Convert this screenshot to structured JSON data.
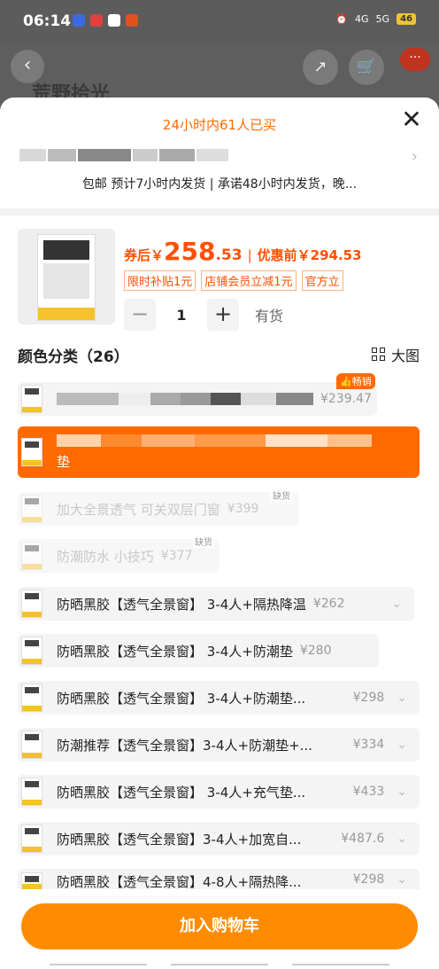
{
  "status_bar": {
    "time": "06:14",
    "right": [
      "4G",
      "5G"
    ],
    "battery": "46"
  },
  "background": {
    "title_hint": "荒野拾光"
  },
  "sheet": {
    "bought_text": "24小时内61人已买",
    "close_icon": "close-icon",
    "delivery_text": "包邮 预计7小时内发货 | 承诺48小时内发货，晚..."
  },
  "product": {
    "after_coupon_label": "券后￥",
    "price_int": "258",
    "price_dec": ".53",
    "separator": "|",
    "original_label": "优惠前￥294.53",
    "tags": [
      "限时补贴1元",
      "店铺会员立减1元",
      "官方立"
    ],
    "quantity": "1",
    "stock": "有货",
    "minus": "−",
    "plus": "+"
  },
  "section": {
    "title": "颜色分类（26）",
    "big_view": "大图"
  },
  "options": [
    {
      "text": "",
      "price": "¥239.47",
      "state": "normal",
      "badge": "畅销"
    },
    {
      "text": "垫",
      "price": "",
      "state": "selected"
    },
    {
      "text": "加大全景透气 可关双层门窗",
      "price": "¥399",
      "state": "disabled",
      "badge": "缺货"
    },
    {
      "text": "防潮防水 小技巧",
      "price": "¥377",
      "state": "disabled",
      "badge": "缺货"
    },
    {
      "text": "防晒黑胶【透气全景窗】 3-4人+隔热降温",
      "price": "¥262",
      "state": "normal"
    },
    {
      "text": "防晒黑胶【透气全景窗】 3-4人+防潮垫",
      "price": "¥280",
      "state": "normal"
    },
    {
      "text": "防晒黑胶【透气全景窗】 3-4人+防潮垫...",
      "price": "¥298",
      "state": "normal"
    },
    {
      "text": "防潮推荐【透气全景窗】3-4人+防潮垫+...",
      "price": "¥334",
      "state": "normal"
    },
    {
      "text": "防晒黑胶【透气全景窗】 3-4人+充气垫...",
      "price": "¥433",
      "state": "normal"
    },
    {
      "text": "防晒黑胶【透气全景窗】3-4人+加宽自...",
      "price": "¥487.6",
      "state": "normal"
    },
    {
      "text": "防晒黑胶【透气全景窗】4-8人+隔热降...",
      "price": "¥298",
      "state": "normal"
    }
  ],
  "footer": {
    "add_to_cart": "加入购物车"
  }
}
